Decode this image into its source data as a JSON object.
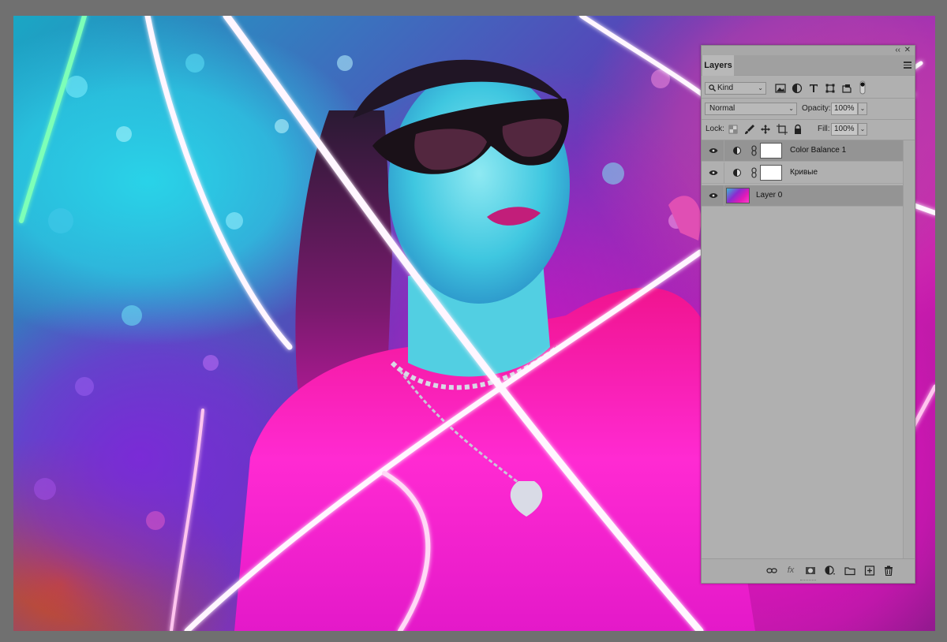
{
  "panel": {
    "tab_label": "Layers",
    "collapse_glyph": "‹‹",
    "close_glyph": "✕",
    "filter": {
      "kind_label": "Kind",
      "icons": [
        "image-filter-icon",
        "adjustment-filter-icon",
        "type-filter-icon",
        "shape-filter-icon",
        "smart-object-filter-icon",
        "filter-toggle-icon"
      ]
    },
    "blend_mode": "Normal",
    "opacity_label": "Opacity:",
    "opacity_value": "100%",
    "lock_label": "Lock:",
    "lock_icons": [
      "lock-transparent-icon",
      "lock-image-icon",
      "lock-position-icon",
      "lock-artboard-icon",
      "lock-all-icon"
    ],
    "fill_label": "Fill:",
    "fill_value": "100%",
    "layers": [
      {
        "name": "Color Balance 1",
        "type": "adjustment",
        "visible": true,
        "selected": true
      },
      {
        "name": "Кривые",
        "type": "adjustment",
        "visible": true,
        "selected": false
      },
      {
        "name": "Layer 0",
        "type": "pixel",
        "visible": true,
        "selected": true
      }
    ],
    "bottom_icons": [
      "link-layers-icon",
      "fx-icon",
      "add-mask-icon",
      "new-adjustment-icon",
      "new-group-icon",
      "new-layer-icon",
      "delete-layer-icon"
    ]
  },
  "colors": {
    "panel_bg": "#b0b0b0",
    "selected_row": "#949494",
    "workspace_bg": "#707070"
  }
}
